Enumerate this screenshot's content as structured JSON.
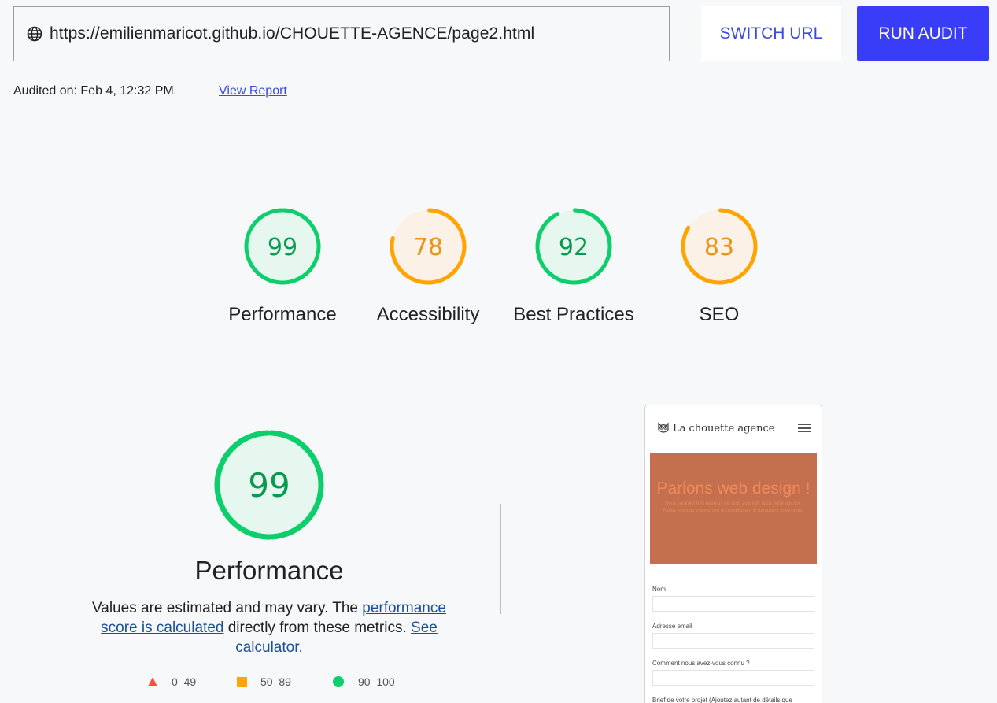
{
  "toolbar": {
    "url": "https://emilienmaricot.github.io/CHOUETTE-AGENCE/page2.html",
    "switch_label": "SWITCH URL",
    "run_label": "RUN AUDIT",
    "globe_icon": "globe-icon"
  },
  "meta": {
    "audited": "Audited on: Feb 4, 12:32 PM",
    "view_report": "View Report"
  },
  "colors": {
    "pass": "#0cce6b",
    "average": "#ffa400",
    "fail": "#ff4e42",
    "accent": "#3a3df7"
  },
  "scores": [
    {
      "label": "Performance",
      "value": 99,
      "level": "pass"
    },
    {
      "label": "Accessibility",
      "value": 78,
      "level": "average"
    },
    {
      "label": "Best Practices",
      "value": 92,
      "level": "pass"
    },
    {
      "label": "SEO",
      "value": 83,
      "level": "average"
    }
  ],
  "performance": {
    "score": 99,
    "title": "Performance",
    "desc_pre": "Values are estimated and may vary. The ",
    "desc_link1": "performance score is calculated",
    "desc_mid": " directly from these metrics. ",
    "desc_link2": "See calculator.",
    "legend": [
      "0–49",
      "50–89",
      "90–100"
    ]
  },
  "screenshot": {
    "logo": "La chouette agence",
    "hero_title": "Parlons web design !",
    "hero_sub": "Nous sommes très heureux de vous accueillir dans notre agence. Parlez-nous de votre projet en remplissant le formulaire ci-dessous.",
    "fields": [
      "Nom",
      "Adresse email",
      "Comment nous avez-vous connu ?",
      "Brief de votre projet (Ajoutez autant de détails que nécessaire)"
    ]
  }
}
